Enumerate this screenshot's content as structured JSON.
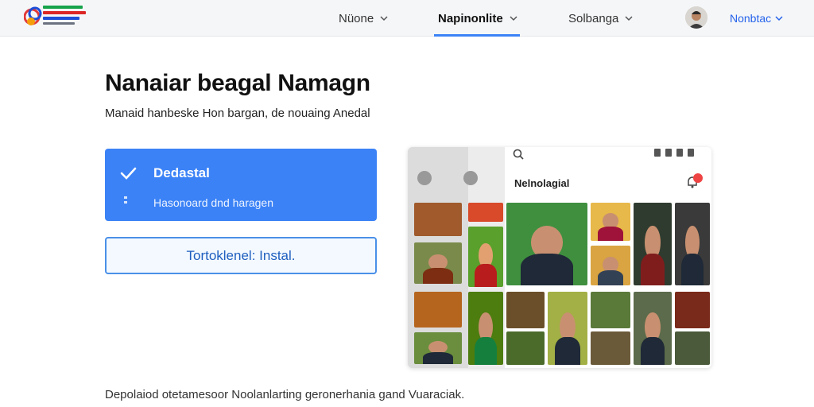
{
  "nav": {
    "items": [
      {
        "label": "Nüone"
      },
      {
        "label": "Napinonlite"
      },
      {
        "label": "Solbanga"
      }
    ],
    "active_index": 1,
    "account_label": "Nonbtac"
  },
  "hero": {
    "title": "Nanaiar beagal Namagn",
    "subtitle": "Manaid hanbeske Hon bargan, de nouaing Anedal"
  },
  "option_card": {
    "title": "Dedastal",
    "description": "Hasonoard dnd haragen"
  },
  "install_button": {
    "label": "Tortoklenel: Instal."
  },
  "preview": {
    "heading": "Nelnolagial",
    "notification_count": "1"
  },
  "footer": {
    "note": "Depolaiod otetamesoor Noolanlarting geronerhania gand Vuaraciak."
  },
  "colors": {
    "accent": "#3b82f6",
    "link": "#2563eb",
    "button_border": "#4a90e8"
  },
  "icons": {
    "logo": "brand-logo",
    "nav_chevron": "chevron-down-icon",
    "option_check": "check-icon",
    "search": "search-icon",
    "notification": "bell-icon"
  }
}
